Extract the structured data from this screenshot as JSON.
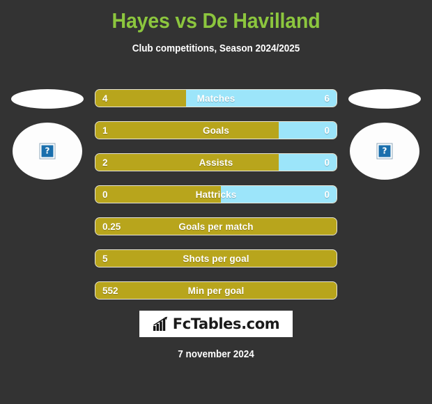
{
  "header": {
    "title": "Hayes vs De Havilland",
    "subtitle": "Club competitions, Season 2024/2025",
    "title_color": "#8cc63e",
    "subtitle_color": "#ffffff"
  },
  "theme": {
    "background": "#333333",
    "home_color": "#b8a51c",
    "away_color": "#9ce5fa",
    "bar_border": "#e8e6d8",
    "text_color": "#ffffff"
  },
  "players": {
    "home": {
      "photo": "broken-image-placeholder",
      "glyph": "?"
    },
    "away": {
      "photo": "broken-image-placeholder",
      "glyph": "?"
    }
  },
  "stats": [
    {
      "label": "Matches",
      "home": "4",
      "away": "6",
      "home_pct": 37.5,
      "two_sided": true
    },
    {
      "label": "Goals",
      "home": "1",
      "away": "0",
      "home_pct": 76,
      "two_sided": true
    },
    {
      "label": "Assists",
      "home": "2",
      "away": "0",
      "home_pct": 76,
      "two_sided": true
    },
    {
      "label": "Hattricks",
      "home": "0",
      "away": "0",
      "home_pct": 52,
      "two_sided": true
    },
    {
      "label": "Goals per match",
      "home": "0.25",
      "away": "",
      "home_pct": 100,
      "two_sided": false
    },
    {
      "label": "Shots per goal",
      "home": "5",
      "away": "",
      "home_pct": 100,
      "two_sided": false
    },
    {
      "label": "Min per goal",
      "home": "552",
      "away": "",
      "home_pct": 100,
      "two_sided": false
    }
  ],
  "logo": {
    "text": "FcTables.com",
    "icon": "bar-chart-growth-icon"
  },
  "footer": {
    "date": "7 november 2024"
  }
}
